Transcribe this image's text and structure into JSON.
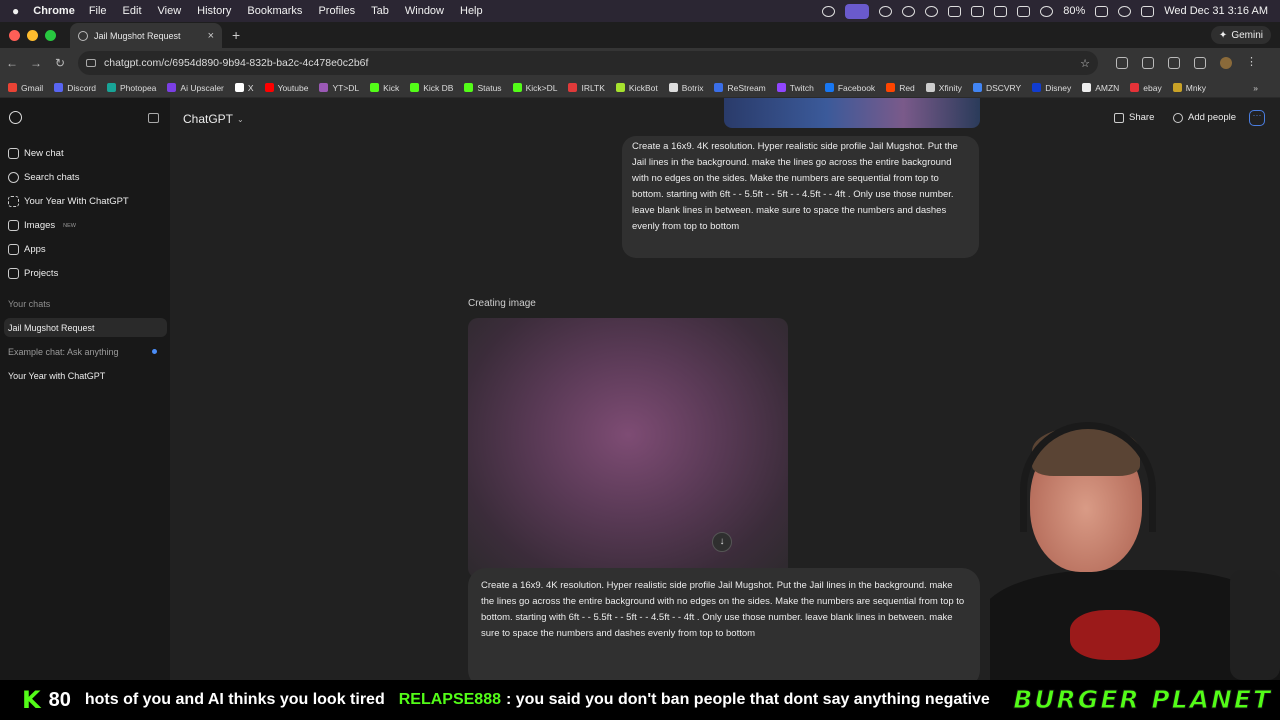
{
  "menubar": {
    "app": "Chrome",
    "items": [
      "File",
      "Edit",
      "View",
      "History",
      "Bookmarks",
      "Profiles",
      "Tab",
      "Window",
      "Help"
    ],
    "battery": "80%",
    "datetime": "Wed Dec 31  3:16 AM"
  },
  "tab": {
    "title": "Jail Mugshot Request",
    "new_tab_symbol": "+",
    "close_symbol": "×"
  },
  "gemini": {
    "label": "Gemini"
  },
  "omnibox": {
    "url": "chatgpt.com/c/6954d890-9b94-832b-ba2c-4c478e0c2b6f"
  },
  "bookmarks": [
    {
      "label": "Gmail",
      "color": "#ea4335"
    },
    {
      "label": "Discord",
      "color": "#5865f2"
    },
    {
      "label": "Photopea",
      "color": "#18a497"
    },
    {
      "label": "Ai Upscaler",
      "color": "#7b3fe4"
    },
    {
      "label": "X",
      "color": "#ffffff"
    },
    {
      "label": "Youtube",
      "color": "#ff0000"
    },
    {
      "label": "YT>DL",
      "color": "#9b59b6"
    },
    {
      "label": "Kick",
      "color": "#53fc18"
    },
    {
      "label": "Kick DB",
      "color": "#53fc18"
    },
    {
      "label": "Status",
      "color": "#53fc18"
    },
    {
      "label": "Kick>DL",
      "color": "#53fc18"
    },
    {
      "label": "IRLTK",
      "color": "#e03a3a"
    },
    {
      "label": "KickBot",
      "color": "#a6e22e"
    },
    {
      "label": "Botrix",
      "color": "#dddddd"
    },
    {
      "label": "ReStream",
      "color": "#3a6ee8"
    },
    {
      "label": "Twitch",
      "color": "#9146ff"
    },
    {
      "label": "Facebook",
      "color": "#1877f2"
    },
    {
      "label": "Red",
      "color": "#ff4500"
    },
    {
      "label": "Xfinity",
      "color": "#cccccc"
    },
    {
      "label": "DSCVRY",
      "color": "#4285f4"
    },
    {
      "label": "Disney",
      "color": "#113ccf"
    },
    {
      "label": "AMZN",
      "color": "#eeeeee"
    },
    {
      "label": "ebay",
      "color": "#e53238"
    },
    {
      "label": "Mnky",
      "color": "#c9a227"
    }
  ],
  "bookmarks_more": "»",
  "sidebar": {
    "items": [
      {
        "label": "New chat"
      },
      {
        "label": "Search chats"
      },
      {
        "label": "Your Year With ChatGPT"
      },
      {
        "label": "Images",
        "badge": "NEW"
      },
      {
        "label": "Apps"
      },
      {
        "label": "Projects"
      }
    ],
    "section_label": "Your chats",
    "chats": [
      {
        "label": "Jail Mugshot Request"
      },
      {
        "label": "Example chat: Ask anything"
      },
      {
        "label": "Your Year with ChatGPT"
      }
    ]
  },
  "header": {
    "title": "ChatGPT",
    "chevron": "⌄",
    "share": "Share",
    "add_people": "Add people",
    "more": "···"
  },
  "conversation": {
    "user_message": "Create a 16x9. 4K resolution. Hyper realistic side profile Jail Mugshot. Put the Jail lines in the background. make the lines go across the entire background with no edges on the sides. Make the numbers are sequential from top to bottom. starting with 6ft - - 5.5ft - - 5ft - - 4.5ft - - 4ft . Only use those number. leave blank lines in between. make sure to space the numbers and dashes evenly from top to bottom",
    "status": "Creating image",
    "scroll_icon": "↓",
    "composer_text": "Create a 16x9. 4K resolution. Hyper realistic side profile Jail Mugshot. Put the Jail lines in the background. make the lines go across the entire background with no edges on the sides. Make the numbers are sequential from top to bottom. starting with 6ft - - 5.5ft - - 5ft - - 4.5ft - - 4ft . Only use those number. leave blank lines in between. make sure to space the numbers and dashes evenly from top to bottom"
  },
  "ticker": {
    "logo": "K",
    "count": "80",
    "message1": "hots of you and AI thinks you look tired",
    "user": "RELAPSE888",
    "message2": ": you said you don't ban people that dont say anything negative",
    "brand": "BURGER PLANET"
  }
}
